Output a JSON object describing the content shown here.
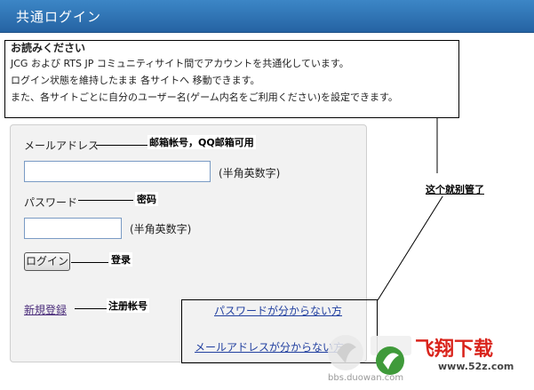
{
  "window": {
    "title": "共通ログイン"
  },
  "notice": {
    "heading": "お読みください",
    "lines": [
      "JCG および RTS JP コミュニティサイト間でアカウントを共通化しています。",
      "ログイン状態を維持したまま 各サイトへ 移動できます。",
      "また、各サイトごとに自分のユーザー名(ゲーム内名をご利用ください)を設定できます。"
    ]
  },
  "form": {
    "email_label": "メールアドレス",
    "email_value": "",
    "email_hint": "(半角英数字)",
    "password_label": "パスワード",
    "password_value": "",
    "password_hint": "(半角英数字)",
    "login_button": "ログイン"
  },
  "links": {
    "register": "新規登録",
    "forgot_password": "パスワードが分からない方",
    "forgot_email": "メールアドレスが分からない方"
  },
  "annotations": {
    "email": "邮箱帐号，QQ邮箱可用",
    "password": "密码",
    "login": "登录",
    "register": "注册帐号",
    "ignore": "这个就别管了"
  },
  "watermark": {
    "brand": "飞翔下载",
    "url": "www.52z.com",
    "sub": "bbs.duowan.com"
  },
  "colors": {
    "titlebar": "#2f74b5",
    "panel": "#f2f2f2",
    "input_border": "#7a9bc4",
    "link_visited": "#4a2c7a",
    "link": "#2240a0",
    "watermark_red": "#d9241c"
  }
}
